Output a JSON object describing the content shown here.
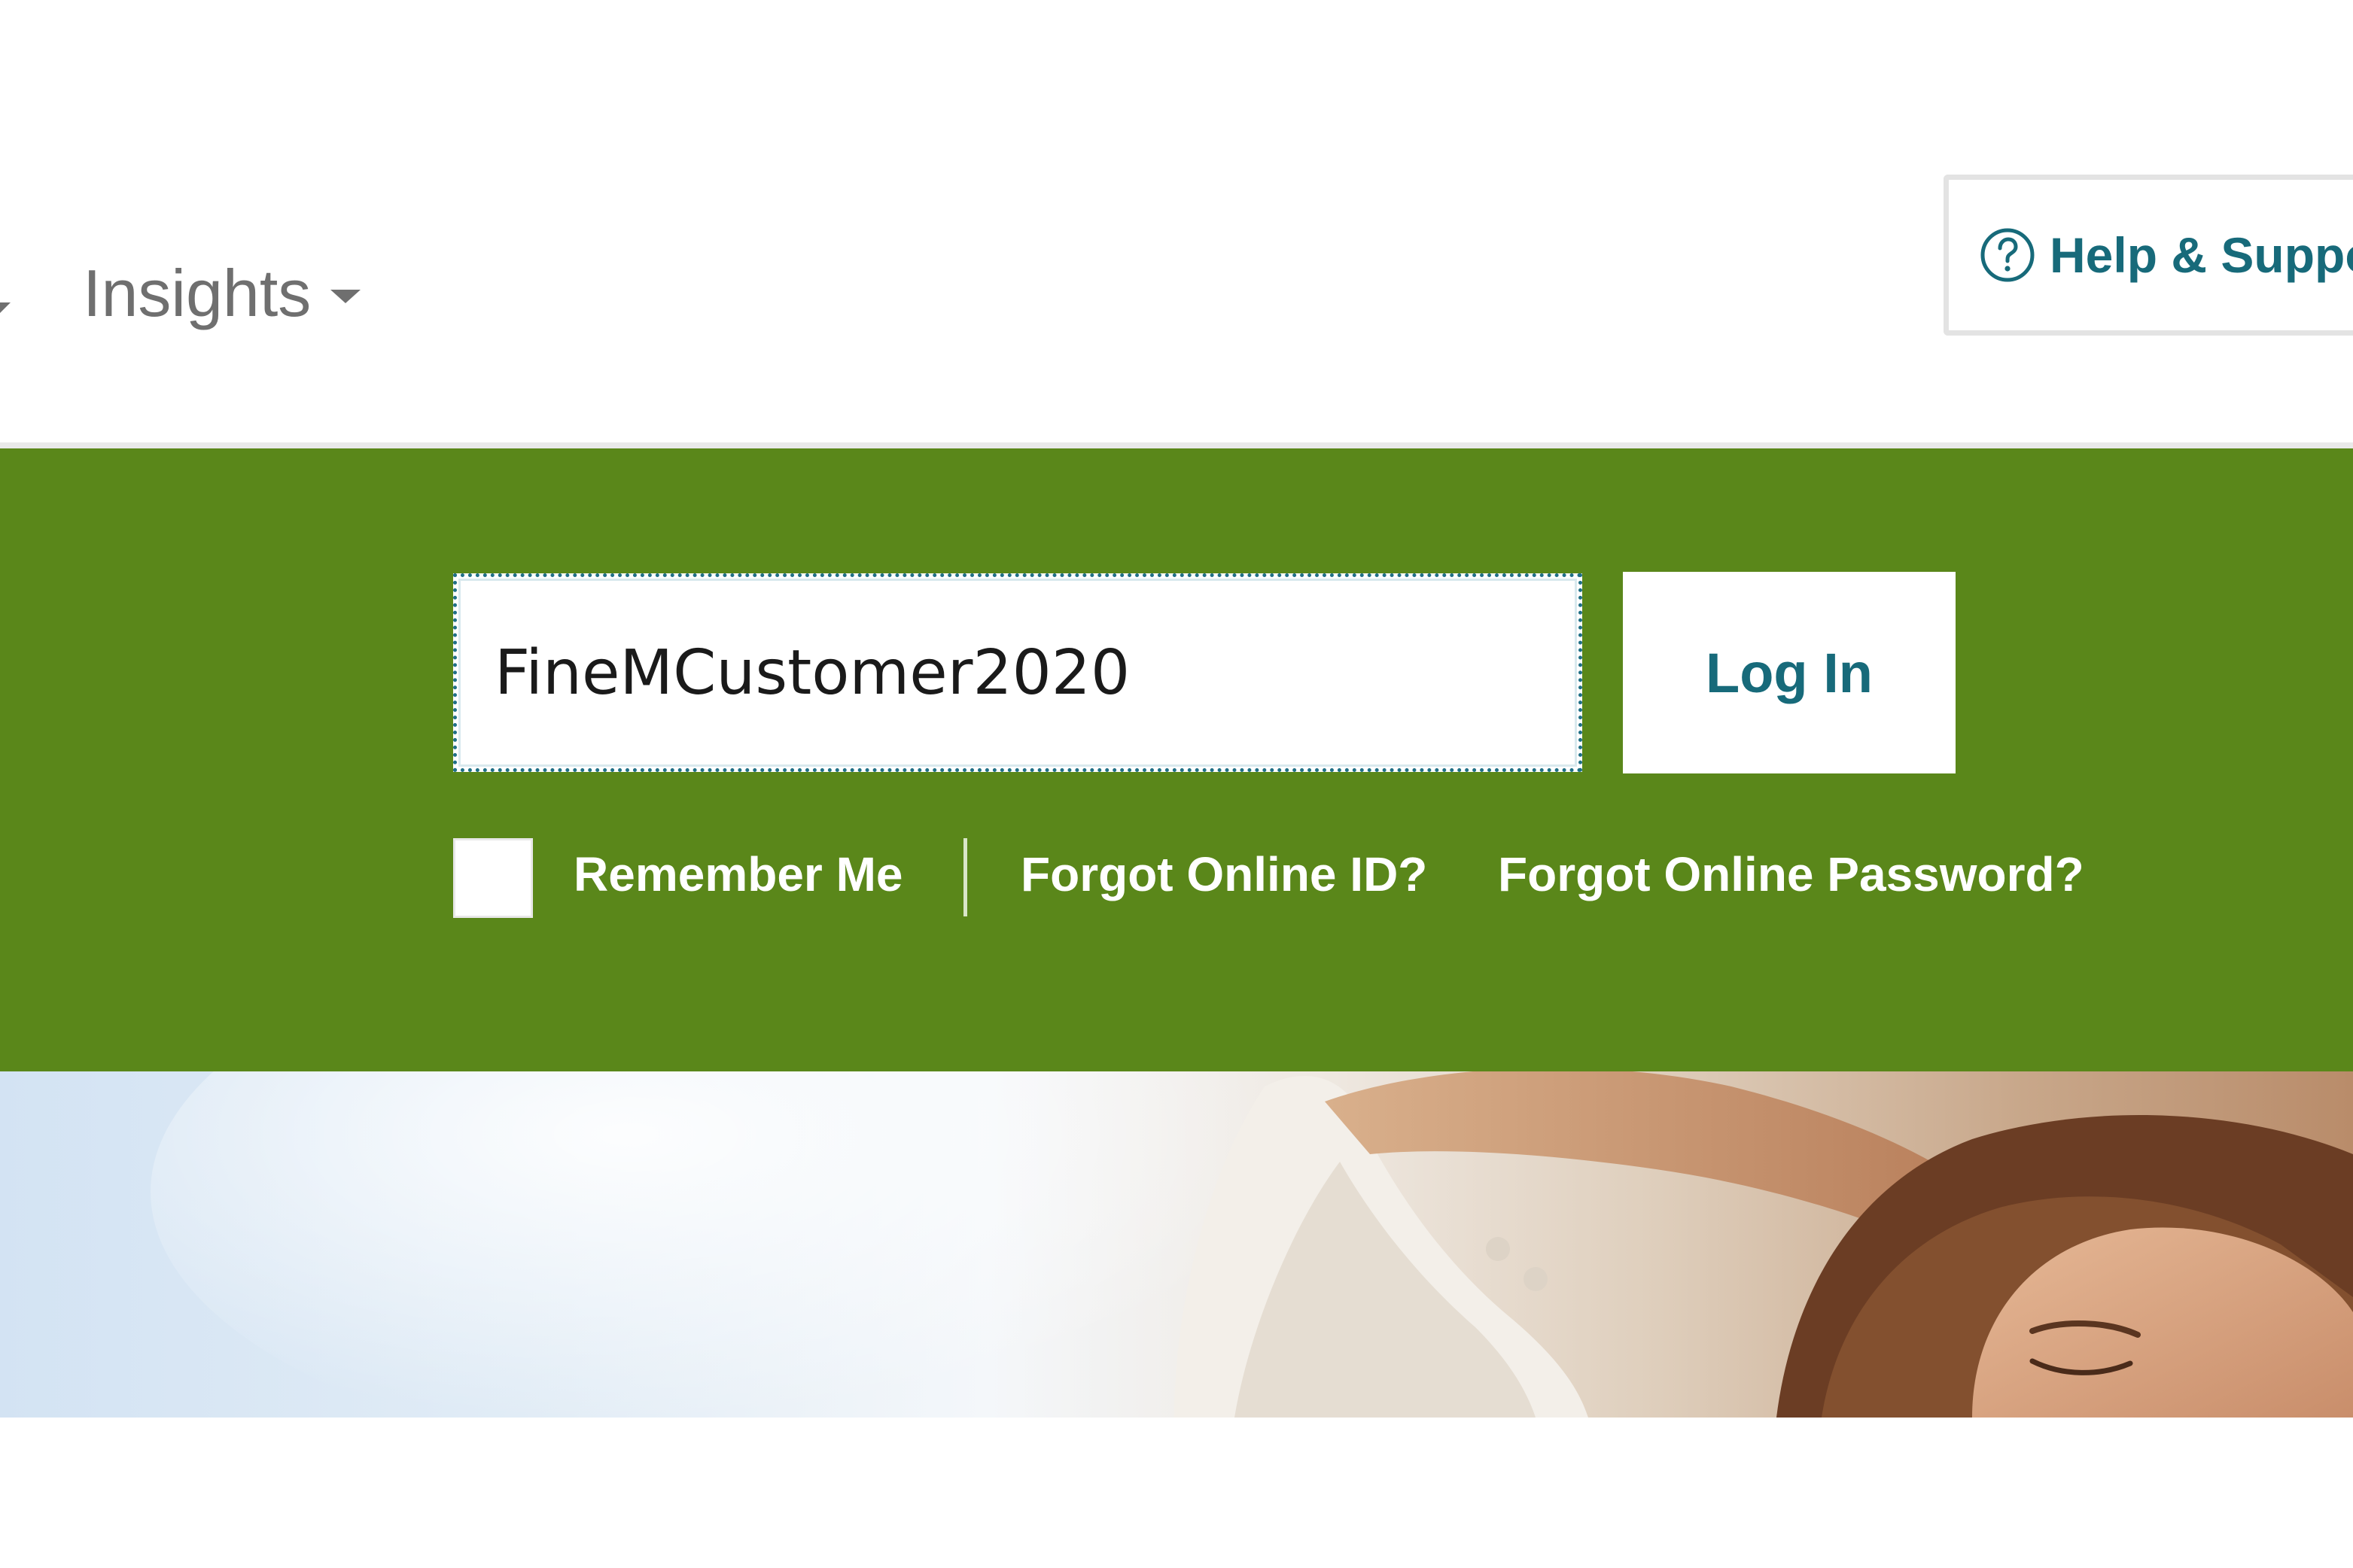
{
  "header": {
    "nav": {
      "insights_label": "Insights"
    },
    "help": {
      "label": "Help & Suppo",
      "icon": "help-circle-icon"
    }
  },
  "login": {
    "online_id": {
      "value": "FineMCustomer2020"
    },
    "login_button_label": "Log In",
    "remember_me_label": "Remember Me",
    "remember_me_checked": false,
    "forgot_id_label": "Forgot Online ID?",
    "forgot_password_label": "Forgot Online Password?"
  },
  "colors": {
    "band_green": "#5a871a",
    "accent_teal": "#176a7a",
    "nav_gray": "#6f6f6f"
  }
}
